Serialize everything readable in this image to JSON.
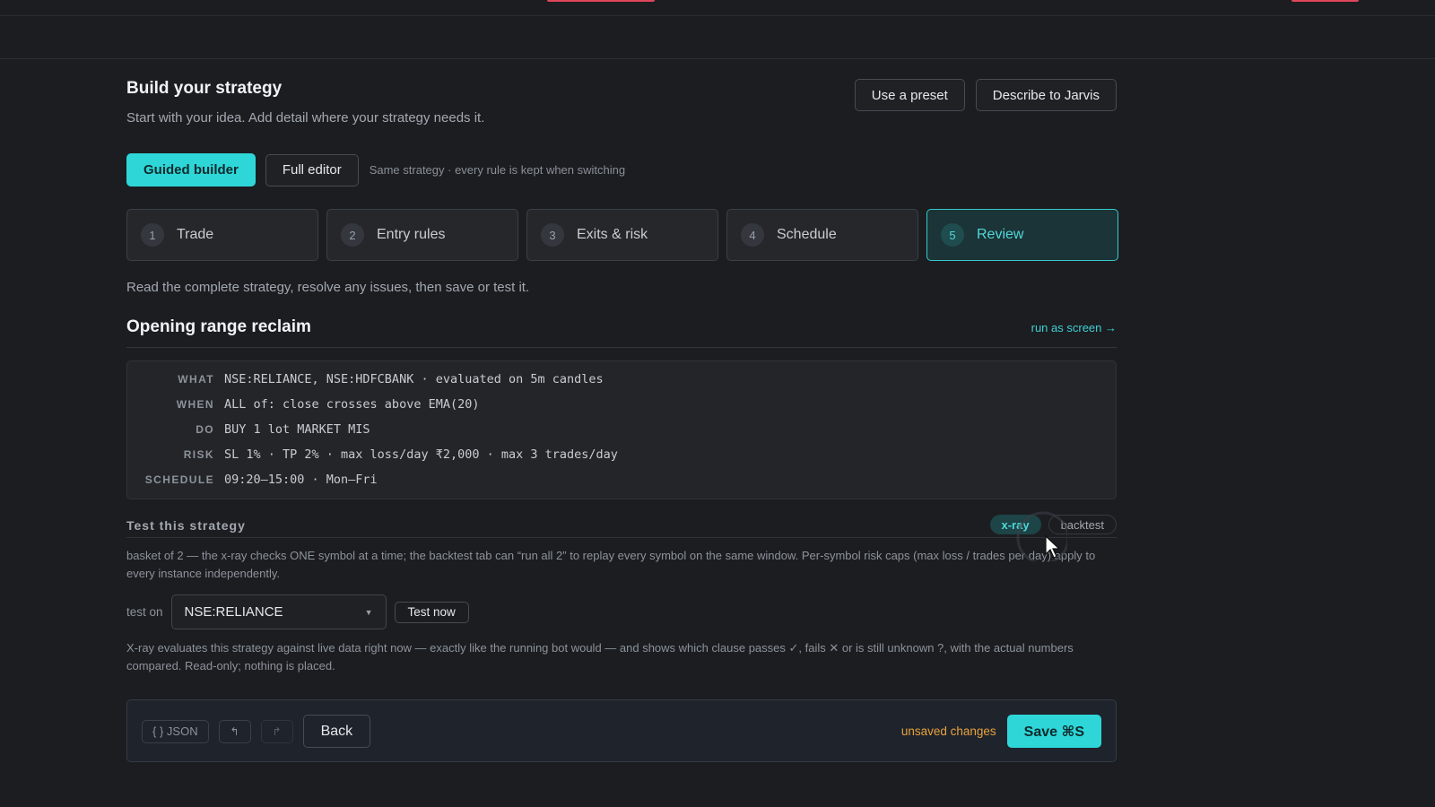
{
  "header": {
    "title": "Build your strategy",
    "subtitle": "Start with your idea. Add detail where your strategy needs it.",
    "preset_label": "Use a preset",
    "jarvis_label": "Describe to Jarvis"
  },
  "mode": {
    "guided_label": "Guided builder",
    "full_label": "Full editor",
    "hint": "Same strategy · every rule is kept when switching"
  },
  "steps": [
    {
      "num": "1",
      "label": "Trade"
    },
    {
      "num": "2",
      "label": "Entry rules"
    },
    {
      "num": "3",
      "label": "Exits & risk"
    },
    {
      "num": "4",
      "label": "Schedule"
    },
    {
      "num": "5",
      "label": "Review"
    }
  ],
  "active_step": 5,
  "review": {
    "description": "Read the complete strategy, resolve any issues, then save or test it.",
    "strategy_name": "Opening range reclaim",
    "run_link": "run as screen →",
    "summary": [
      {
        "key": "WHAT",
        "value": "NSE:RELIANCE, NSE:HDFCBANK · evaluated on 5m candles"
      },
      {
        "key": "WHEN",
        "value": "ALL of: close crosses above EMA(20)"
      },
      {
        "key": "DO",
        "value": "BUY 1 lot MARKET MIS"
      },
      {
        "key": "RISK",
        "value": "SL 1% · TP 2% · max loss/day ₹2,000 · max 3 trades/day"
      },
      {
        "key": "SCHEDULE",
        "value": "09:20–15:00 · Mon–Fri"
      }
    ]
  },
  "test": {
    "title": "Test this strategy",
    "tab_xray": "x-ray",
    "tab_backtest": "backtest",
    "basket_note": "basket of 2 — the x-ray checks ONE symbol at a time; the backtest tab can “run all 2” to replay every symbol on the same window. Per-symbol risk caps (max loss / trades per day) apply to every instance independently.",
    "test_on_label": "test on",
    "symbol_value": "NSE:RELIANCE",
    "test_now_label": "Test now",
    "xray_note": "X-ray evaluates this strategy against live data right now — exactly like the running bot would — and shows which clause passes ✓, fails ✕ or is still unknown ?, with the actual numbers compared. Read-only; nothing is placed."
  },
  "footer": {
    "json_label": "{ } JSON",
    "undo_icon": "↰",
    "redo_icon": "↱",
    "back_label": "Back",
    "unsaved_label": "unsaved changes",
    "save_label": "Save ⌘S"
  },
  "colors": {
    "accent": "#2ed6d8",
    "warning": "#e8a33d",
    "background": "#1b1d21"
  }
}
